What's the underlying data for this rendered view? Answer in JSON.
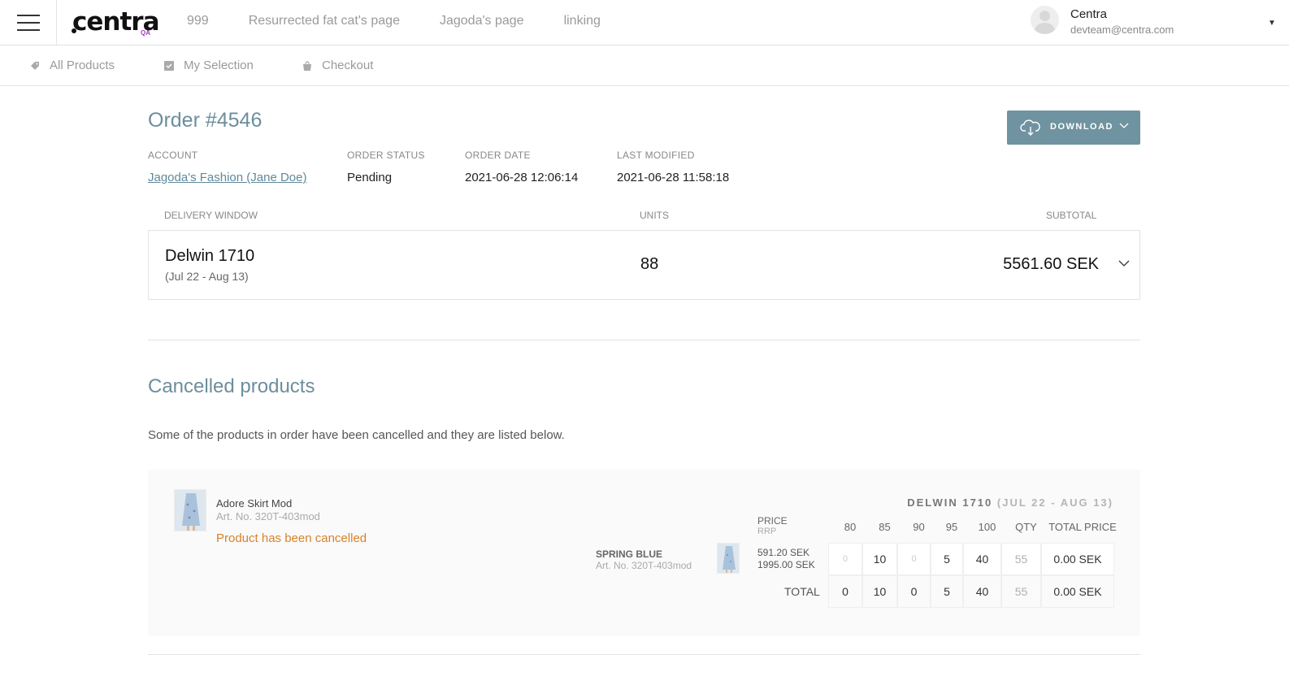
{
  "header": {
    "logo_text": "centra",
    "logo_badge": "QA",
    "nav": [
      "999",
      "Resurrected fat cat's page",
      "Jagoda's page",
      "linking"
    ],
    "user": {
      "name": "Centra",
      "email": "devteam@centra.com"
    }
  },
  "subnav": [
    {
      "label": "All Products",
      "icon": "tag-icon"
    },
    {
      "label": "My Selection",
      "icon": "checkbox-icon"
    },
    {
      "label": "Checkout",
      "icon": "bag-icon"
    }
  ],
  "order": {
    "title": "Order #4546",
    "download_label": "DOWNLOAD",
    "account_label": "ACCOUNT",
    "account_value": "Jagoda's Fashion (Jane Doe)",
    "status_label": "ORDER STATUS",
    "status_value": "Pending",
    "date_label": "ORDER DATE",
    "date_value": "2021-06-28 12:06:14",
    "modified_label": "LAST MODIFIED",
    "modified_value": "2021-06-28 11:58:18"
  },
  "delivery": {
    "col_window": "DELIVERY WINDOW",
    "col_units": "UNITS",
    "col_subtotal": "SUBTOTAL",
    "name": "Delwin 1710",
    "range": "(Jul 22 - Aug 13)",
    "units": "88",
    "subtotal": "5561.60 SEK"
  },
  "cancelled": {
    "title": "Cancelled products",
    "description": "Some of the products in order have been cancelled and they are listed below.",
    "product": {
      "name": "Adore Skirt Mod",
      "art_no": "Art. No. 320T-403mod",
      "status": "Product has been cancelled"
    },
    "window_name": "DELWIN 1710",
    "window_range": "(JUL 22 - AUG 13)",
    "price_label": "PRICE",
    "rrp_label": "RRP",
    "sizes": [
      "80",
      "85",
      "90",
      "95",
      "100"
    ],
    "qty_label": "QTY",
    "total_price_label": "TOTAL PRICE",
    "variant": {
      "name": "SPRING BLUE",
      "art_no": "Art. No. 320T-403mod",
      "price": "591.20 SEK",
      "rrp": "1995.00 SEK",
      "quantities": [
        "0",
        "10",
        "0",
        "5",
        "40"
      ],
      "qty": "55",
      "total": "0.00 SEK"
    },
    "totals": {
      "label": "TOTAL",
      "quantities": [
        "0",
        "10",
        "0",
        "5",
        "40"
      ],
      "qty": "55",
      "total": "0.00 SEK"
    }
  }
}
